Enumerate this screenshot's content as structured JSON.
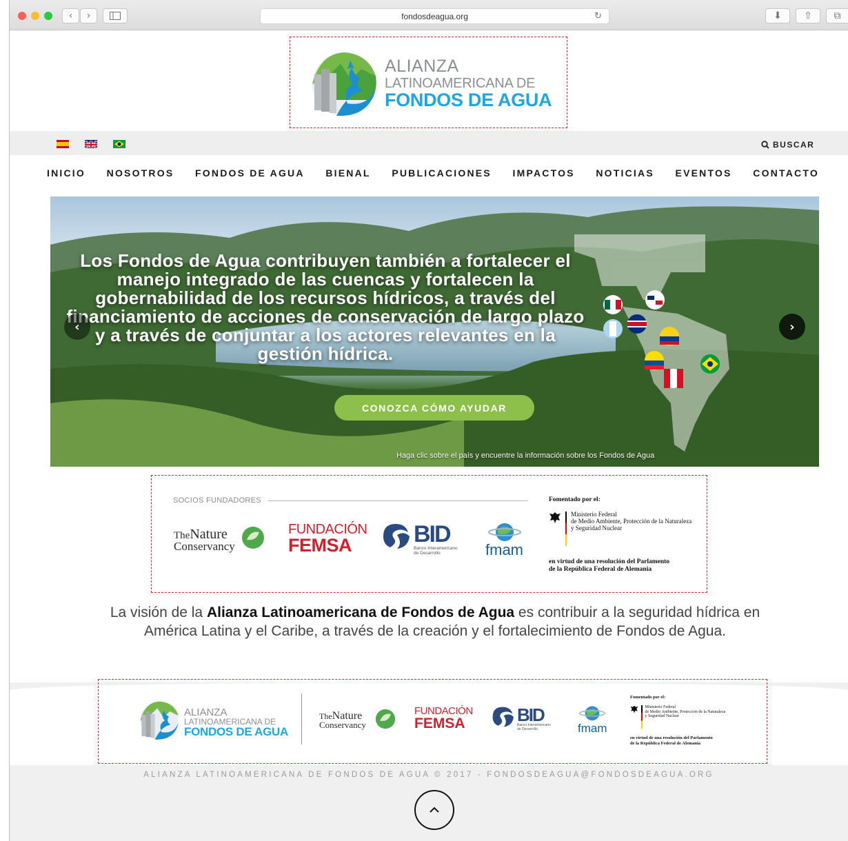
{
  "browser": {
    "url": "fondosdeagua.org",
    "back_glyph": "‹",
    "forward_glyph": "›",
    "reload_glyph": "↻",
    "download_glyph": "⬇",
    "share_glyph": "⇧",
    "tabs_glyph": "⧉"
  },
  "header": {
    "logo_line1": "ALIANZA",
    "logo_line2": "LATINOAMERICANA DE",
    "logo_line3": "FONDOS DE AGUA"
  },
  "utility_bar": {
    "languages": [
      "es",
      "en",
      "pt"
    ],
    "search_label": "BUSCAR"
  },
  "nav": {
    "items": [
      "INICIO",
      "NOSOTROS",
      "FONDOS DE AGUA",
      "BIENAL",
      "PUBLICACIONES",
      "IMPACTOS",
      "NOTICIAS",
      "EVENTOS",
      "CONTACTO"
    ]
  },
  "hero": {
    "headline": "Los Fondos de Agua contribuyen también a fortalecer el manejo integrado de las cuencas y fortalecen la gobernabilidad de los recursos hídricos, a través del financiamiento de acciones de conservación de largo plazo y a través de conjuntar a los actores relevantes en la gestión hídrica.",
    "cta_label": "CONOZCA CÓMO AYUDAR",
    "map_caption": "Haga clic sobre el país y encuentre la información sobre los Fondos de Agua",
    "prev_glyph": "‹",
    "next_glyph": "›"
  },
  "partners": {
    "label": "SOCIOS FUNDADORES",
    "tnc_the": "The",
    "tnc_nature": "Nature",
    "tnc_conservancy": "Conservancy",
    "femsa_fundacion": "FUNDACIÓN",
    "femsa_name": "FEMSA",
    "bid_name": "BID",
    "bid_sub1": "Banco Interamericano",
    "bid_sub2": "de Desarrollo",
    "fmam_name": "fmam",
    "fomentado_head": "Fomentado por el:",
    "ministerio_1": "Ministerio Federal",
    "ministerio_2": "de Medio Ambiente, Protección de la Naturaleza",
    "ministerio_3": "y Seguridad Nuclear",
    "resolucion_1": "en virtud de una resolución del Parlamento",
    "resolucion_2": "de la República Federal de Alemania"
  },
  "vision": {
    "prefix": "La visión de la ",
    "bold": "Alianza Latinoamericana de Fondos de Agua",
    "suffix": " es contribuir a la seguridad hídrica en América Latina y el Caribe, a través de la creación y el fortalecimiento de Fondos de Agua."
  },
  "footer": {
    "copyright": "ALIANZA LATINOAMERICANA DE FONDOS DE AGUA © 2017 - FONDOSDEAGUA@FONDOSDEAGUA.ORG",
    "back_to_top_glyph": "^"
  },
  "colors": {
    "brand_blue": "#1da6df",
    "brand_gray": "#8b8f94",
    "cta_green": "#8cc04b",
    "annotation_red": "#e0262a"
  }
}
